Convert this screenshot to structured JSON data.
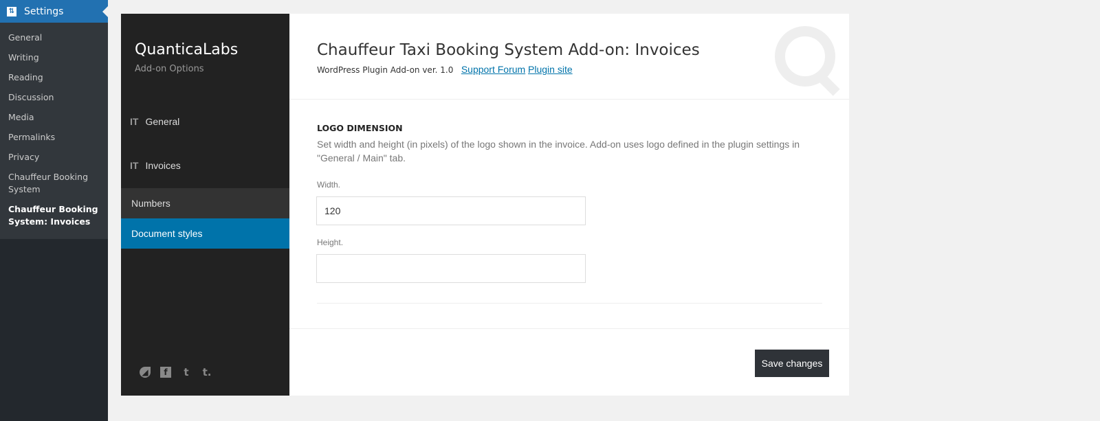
{
  "wp_menu": {
    "header": "Settings",
    "items": [
      "General",
      "Writing",
      "Reading",
      "Discussion",
      "Media",
      "Permalinks",
      "Privacy",
      "Chauffeur Booking System",
      "Chauffeur Booking System: Invoices"
    ],
    "current": 8
  },
  "sidebar": {
    "brand": "QuanticaLabs",
    "subtitle": "Add-on Options",
    "menus": [
      "General",
      "Invoices"
    ],
    "submenus": [
      "Numbers",
      "Document styles"
    ],
    "social": [
      "envato-icon",
      "facebook-icon",
      "twitter-icon",
      "tumblr-icon"
    ]
  },
  "header": {
    "title": "Chauffeur Taxi Booking System Add-on: Invoices",
    "version": "WordPress Plugin Add-on ver. 1.0",
    "support_link": "Support Forum",
    "site_link": "Plugin site"
  },
  "section": {
    "title": "LOGO DIMENSION",
    "description": "Set width and height (in pixels) of the logo shown in the invoice. Add-on uses logo defined in the plugin settings in \"General / Main\" tab.",
    "width_label": "Width.",
    "width_value": "120",
    "height_label": "Height.",
    "height_value": ""
  },
  "save_label": "Save changes"
}
